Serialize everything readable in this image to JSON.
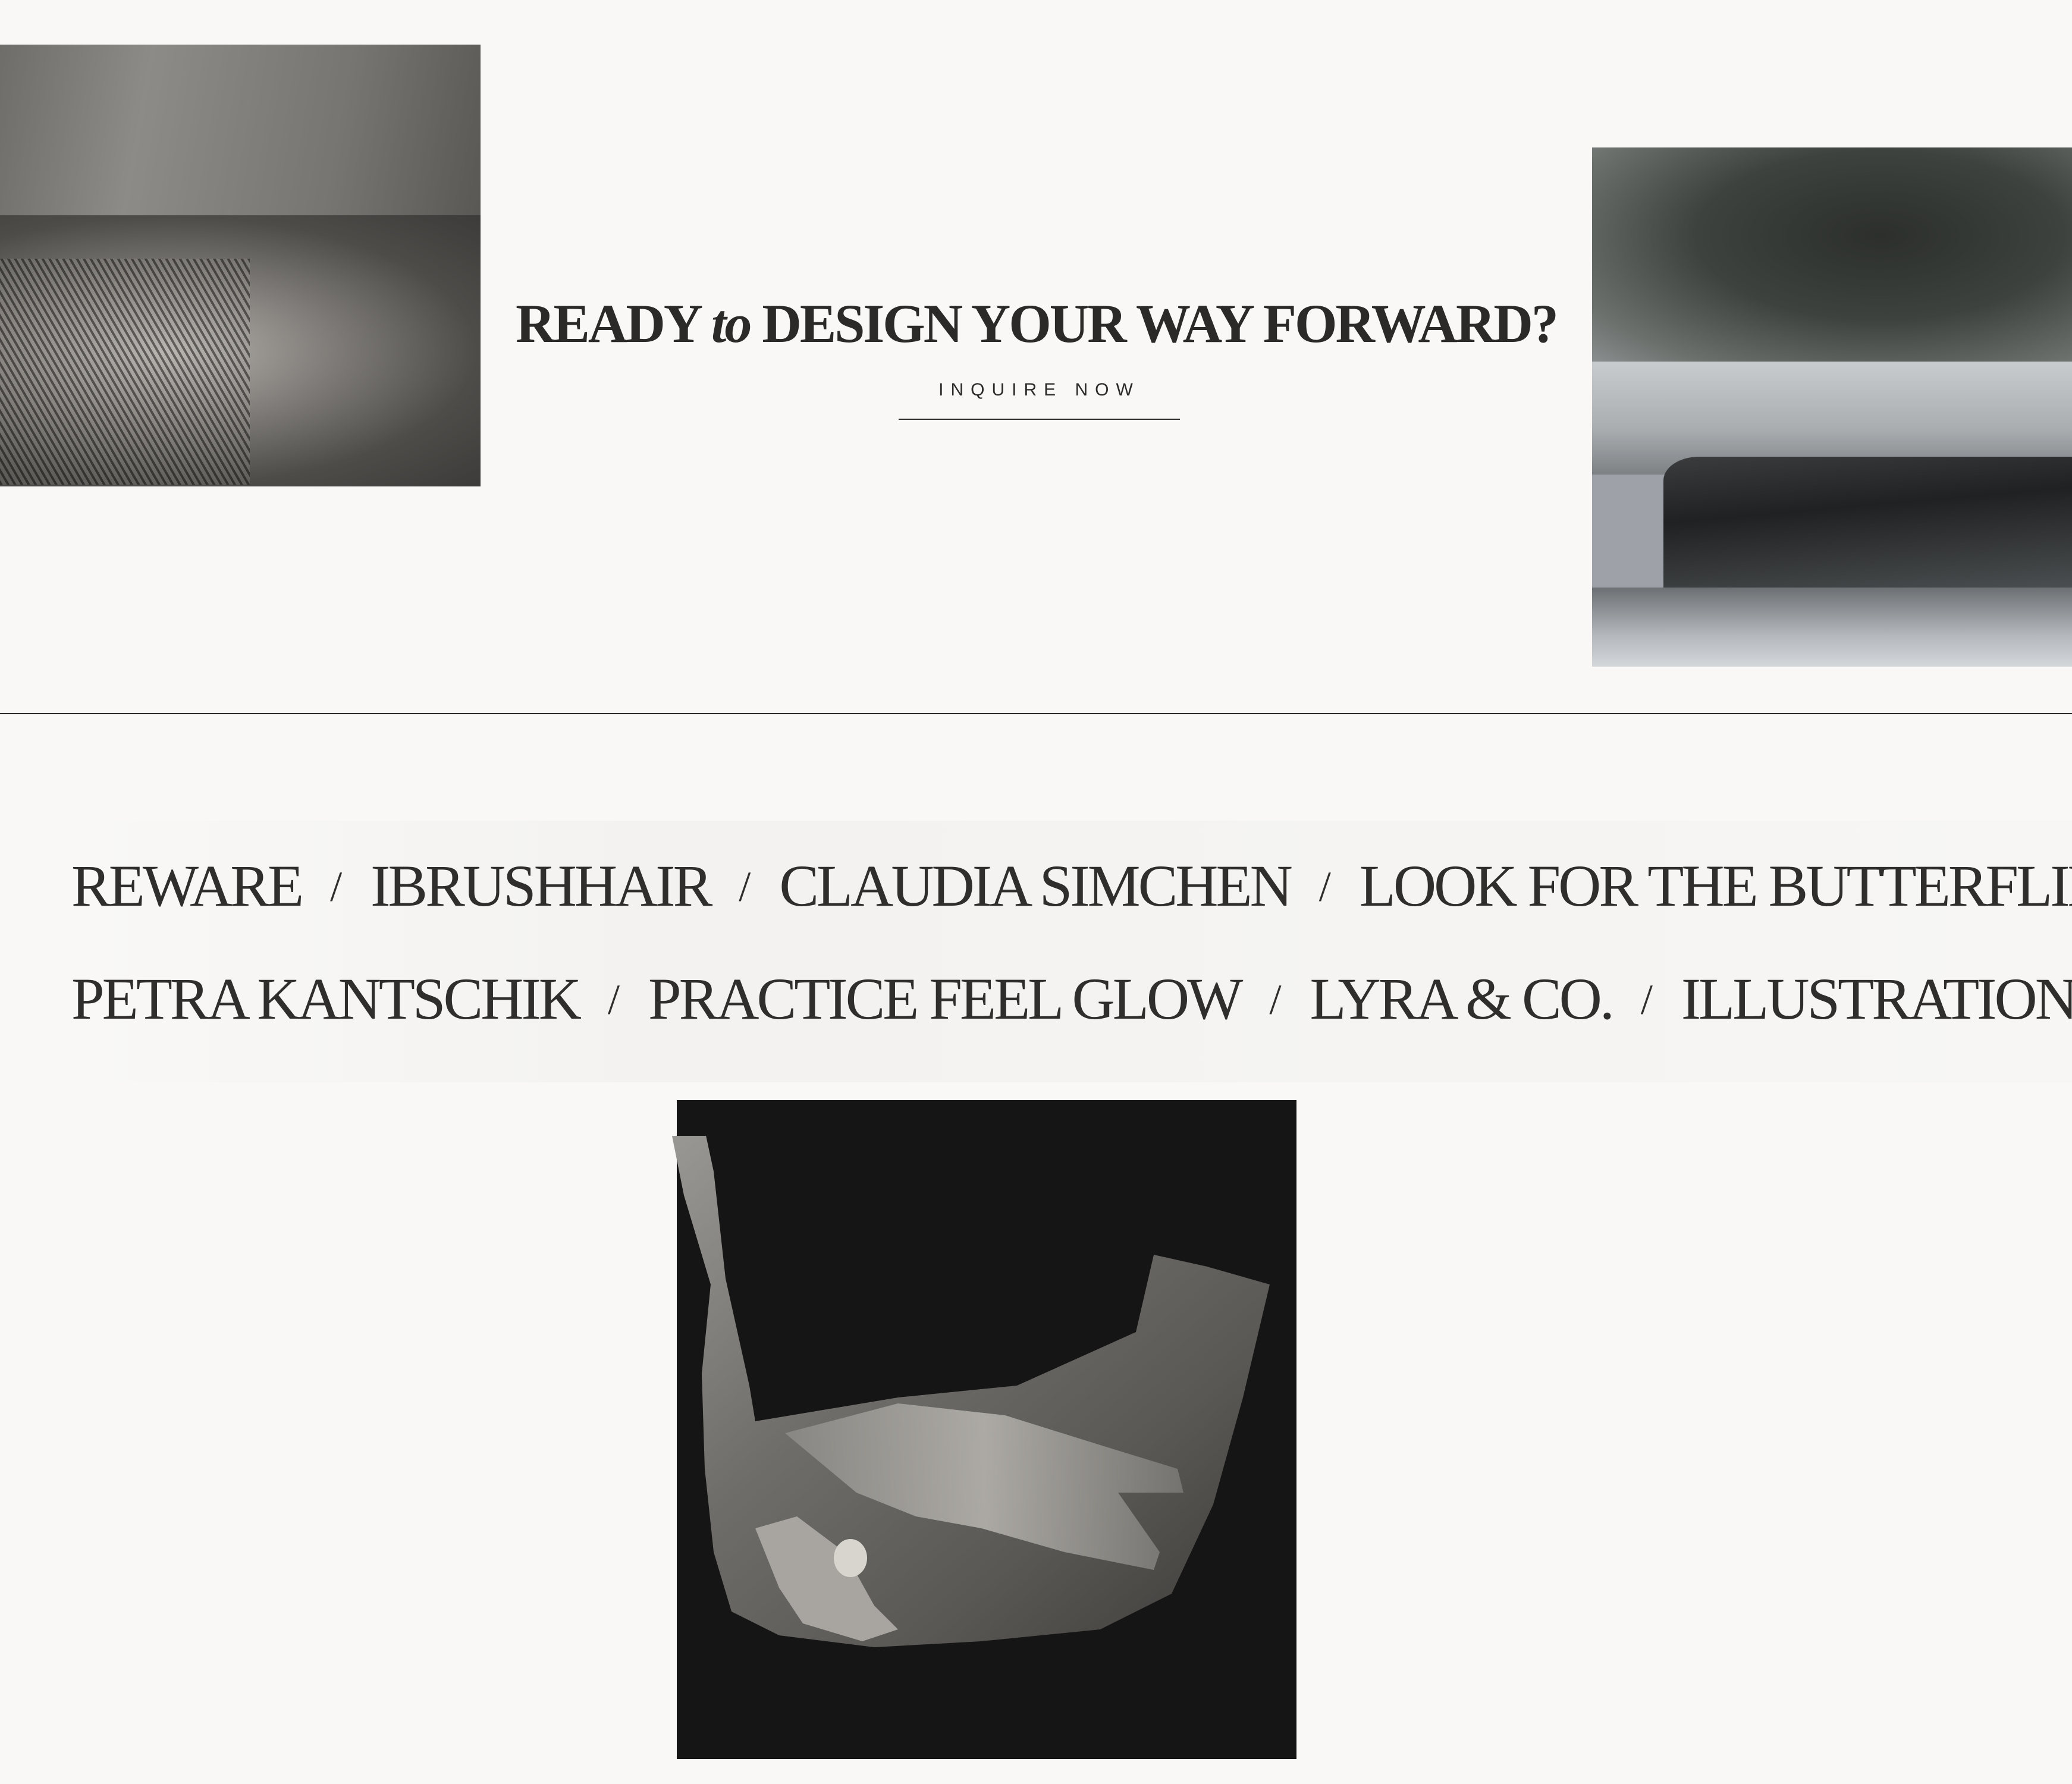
{
  "hero": {
    "headline_part1": "READY ",
    "headline_italic": "to",
    "headline_part2": " DESIGN YOUR WAY FORWARD?",
    "cta_label": "INQUIRE NOW"
  },
  "clients": {
    "row1": [
      {
        "label": "REWARE"
      },
      {
        "label": "IBRUSHHAIR"
      },
      {
        "label": "CLAUDIA SIMCHEN"
      },
      {
        "label": "LOOK FOR THE BUTTERFLIES"
      }
    ],
    "row2": [
      {
        "label": "PETRA KANTSCHIK"
      },
      {
        "label": "PRACTICE FEEL GLOW"
      },
      {
        "label": "LYRA & CO."
      },
      {
        "label": "ILLUSTRATIONS"
      }
    ],
    "separator": "/"
  },
  "colors": {
    "background": "#f9f8f6",
    "text": "#2b2a28",
    "collage_black": "#151515"
  }
}
